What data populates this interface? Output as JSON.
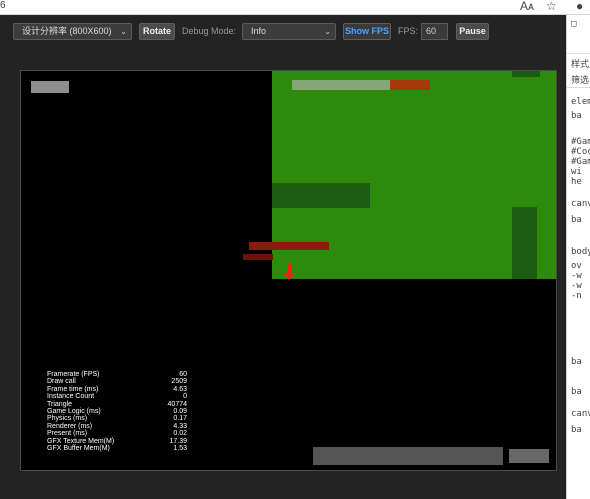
{
  "browser": {
    "tab_fragment": "6",
    "icons": [
      "read-aloud-icon",
      "favorite-star-icon",
      "profile-icon"
    ]
  },
  "toolbar": {
    "resolution_select": "设计分辨率 (800X600)",
    "rotate_button": "Rotate",
    "debug_mode_label": "Debug Mode:",
    "debug_mode_select": "Info",
    "show_fps_button": "Show FPS",
    "fps_label": "FPS:",
    "fps_value": "60",
    "pause_button": "Pause"
  },
  "stats": {
    "rows": [
      {
        "label": "Framerate (FPS)",
        "value": "60"
      },
      {
        "label": "Draw call",
        "value": "2509"
      },
      {
        "label": "Frame time (ms)",
        "value": "4.63"
      },
      {
        "label": "Instance Count",
        "value": "0"
      },
      {
        "label": "Triangle",
        "value": "40774"
      },
      {
        "label": "Game Logic (ms)",
        "value": "0.09"
      },
      {
        "label": "Physics (ms)",
        "value": "0.17"
      },
      {
        "label": "Renderer (ms)",
        "value": "4.33"
      },
      {
        "label": "Present (ms)",
        "value": "0.02"
      },
      {
        "label": "GFX Texture Mem(M)",
        "value": "17.39"
      },
      {
        "label": "GFX Buffer Mem(M)",
        "value": "1.53"
      }
    ]
  },
  "devtools": {
    "lines": [
      "样式",
      "筛选",
      "eleme",
      "ba",
      "#Gam",
      "#Coc",
      "#Gam",
      "wi",
      "he",
      "canv",
      "ba",
      "body",
      "ov",
      "-w",
      "-w",
      "-n",
      "ba",
      "ba",
      "canv",
      "ba"
    ]
  },
  "colors": {
    "map_green": "#2d8a0b",
    "minimap_border": "#d33a2a",
    "show_fps_accent": "#4aa6ff"
  }
}
